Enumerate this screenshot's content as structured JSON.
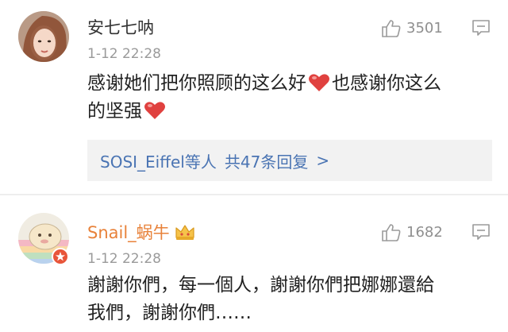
{
  "comments": [
    {
      "username": "安七七呐",
      "time": "1-12 22:28",
      "likes": "3501",
      "text_lines": [
        "感谢她们把你照顾的这么好",
        "也感谢你这么",
        "的坚强"
      ],
      "replies": {
        "names": "SOSI_Eiffel等人",
        "count": "共47条回复",
        "chevron": ">"
      }
    },
    {
      "username": "Snail_蜗牛",
      "time": "1-12 22:28",
      "likes": "1682",
      "text_lines": [
        "謝謝你們，每一個人，謝謝你們把娜娜還給",
        "我們，謝謝你們……"
      ]
    }
  ],
  "colors": {
    "username_highlight": "#e8823a",
    "link": "#4a74b3",
    "heart": "#e0413f",
    "muted": "#9a9a9a"
  },
  "icons": [
    "thumb-up-icon",
    "comment-menu-icon",
    "heart-icon",
    "crown-badge-icon"
  ]
}
